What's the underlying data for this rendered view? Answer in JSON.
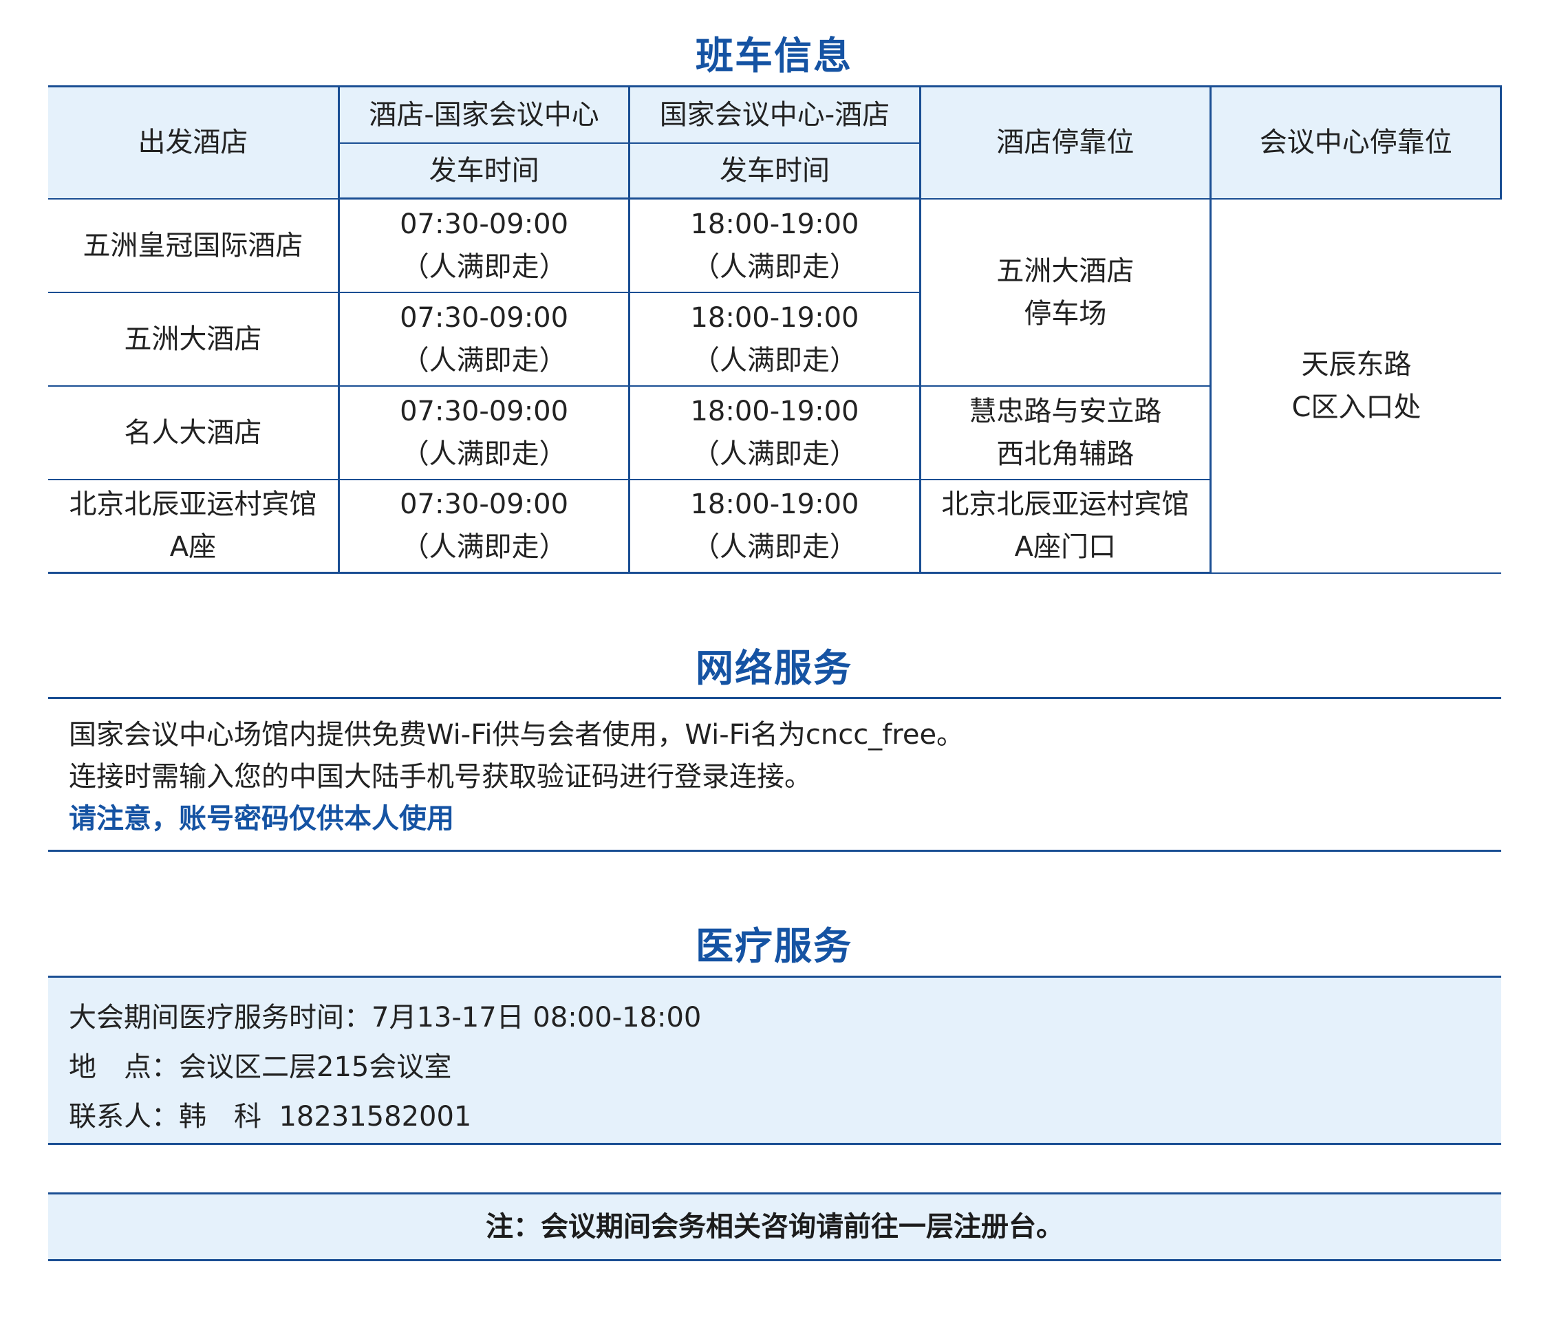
{
  "shuttle": {
    "title": "班车信息",
    "headers": {
      "depart_hotel": "出发酒店",
      "to_center": "酒店-国家会议中心",
      "to_hotel": "国家会议中心-酒店",
      "depart_time": "发车时间",
      "hotel_stop": "酒店停靠位",
      "center_stop": "会议中心停靠位"
    },
    "rows": [
      {
        "hotel": [
          "五洲皇冠国际酒店"
        ],
        "out_time": "07:30-09:00",
        "out_note": "（人满即走）",
        "back_time": "18:00-19:00",
        "back_note": "（人满即走）"
      },
      {
        "hotel": [
          "五洲大酒店"
        ],
        "out_time": "07:30-09:00",
        "out_note": "（人满即走）",
        "back_time": "18:00-19:00",
        "back_note": "（人满即走）"
      },
      {
        "hotel": [
          "名人大酒店"
        ],
        "out_time": "07:30-09:00",
        "out_note": "（人满即走）",
        "back_time": "18:00-19:00",
        "back_note": "（人满即走）"
      },
      {
        "hotel": [
          "北京北辰亚运村宾馆",
          "A座"
        ],
        "out_time": "07:30-09:00",
        "out_note": "（人满即走）",
        "back_time": "18:00-19:00",
        "back_note": "（人满即走）"
      }
    ],
    "hotel_stops": [
      [
        "五洲大酒店",
        "停车场"
      ],
      [
        "慧忠路与安立路",
        "西北角辅路"
      ],
      [
        "北京北辰亚运村宾馆",
        "A座门口"
      ]
    ],
    "center_stop": [
      "天辰东路",
      "C区入口处"
    ]
  },
  "network": {
    "title": "网络服务",
    "line1": "国家会议中心场馆内提供免费Wi-Fi供与会者使用，Wi-Fi名为cncc_free。",
    "line2": "连接时需输入您的中国大陆手机号获取验证码进行登录连接。",
    "notice": "请注意，账号密码仅供本人使用"
  },
  "medical": {
    "title": "医疗服务",
    "time_label": "大会期间医疗服务时间：",
    "time_value": "7月13-17日 08:00-18:00",
    "place_label": "地　点：",
    "place_value": "会议区二层215会议室",
    "contact_label": "联系人：",
    "contact_name": "韩　科",
    "contact_phone": "18231582001"
  },
  "footer": {
    "note": "注：会议期间会务相关咨询请前往一层注册台。"
  },
  "colors": {
    "accent": "#1553a3",
    "border": "#1a4e93",
    "header_bg": "#e5f1fb"
  }
}
